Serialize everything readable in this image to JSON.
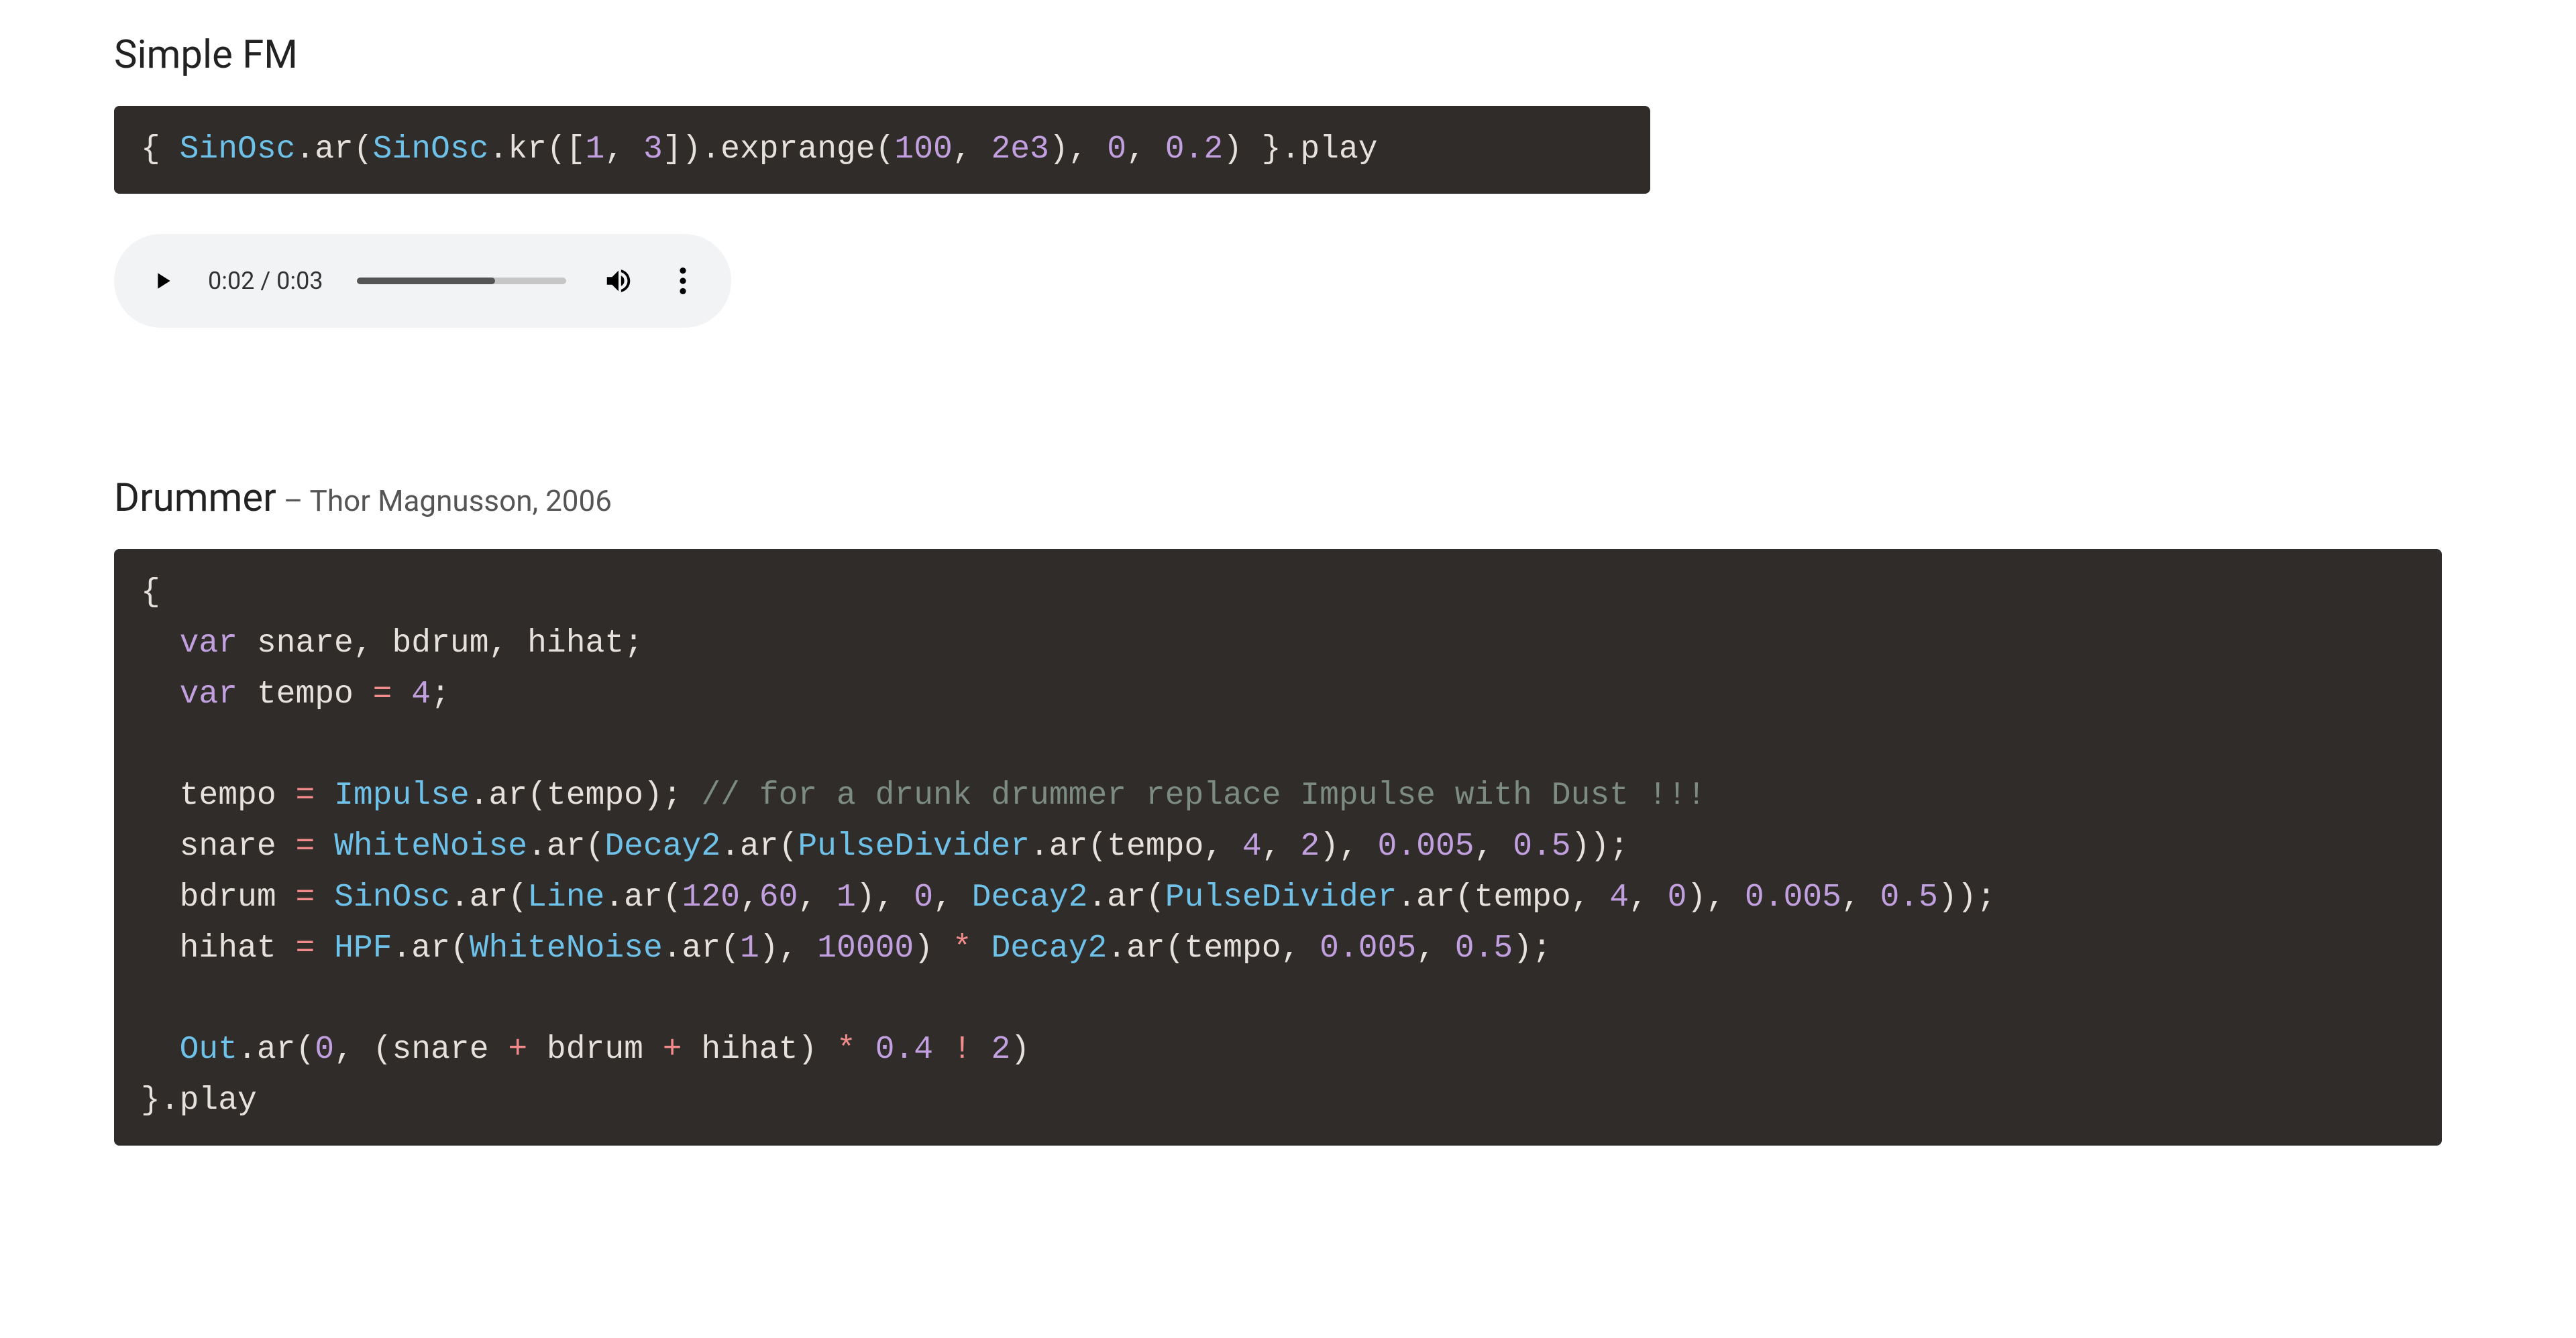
{
  "sections": {
    "fm": {
      "title": "Simple FM",
      "byline": "",
      "code_tokens": [
        {
          "t": "plain",
          "v": "{ "
        },
        {
          "t": "class",
          "v": "SinOsc"
        },
        {
          "t": "plain",
          "v": ".ar("
        },
        {
          "t": "class",
          "v": "SinOsc"
        },
        {
          "t": "plain",
          "v": ".kr(["
        },
        {
          "t": "num",
          "v": "1"
        },
        {
          "t": "plain",
          "v": ", "
        },
        {
          "t": "num",
          "v": "3"
        },
        {
          "t": "plain",
          "v": "]).exprange("
        },
        {
          "t": "num",
          "v": "100"
        },
        {
          "t": "plain",
          "v": ", "
        },
        {
          "t": "num",
          "v": "2e3"
        },
        {
          "t": "plain",
          "v": "), "
        },
        {
          "t": "num",
          "v": "0"
        },
        {
          "t": "plain",
          "v": ", "
        },
        {
          "t": "num",
          "v": "0.2"
        },
        {
          "t": "plain",
          "v": ") }.play"
        }
      ]
    },
    "drummer": {
      "title": "Drummer",
      "byline": " – Thor Magnusson, 2006",
      "code_lines": [
        [
          {
            "t": "plain",
            "v": "{"
          }
        ],
        [
          {
            "t": "plain",
            "v": "  "
          },
          {
            "t": "key",
            "v": "var"
          },
          {
            "t": "plain",
            "v": " snare, bdrum, hihat;"
          }
        ],
        [
          {
            "t": "plain",
            "v": "  "
          },
          {
            "t": "key",
            "v": "var"
          },
          {
            "t": "plain",
            "v": " tempo "
          },
          {
            "t": "op",
            "v": "="
          },
          {
            "t": "plain",
            "v": " "
          },
          {
            "t": "num",
            "v": "4"
          },
          {
            "t": "plain",
            "v": ";"
          }
        ],
        [
          {
            "t": "plain",
            "v": ""
          }
        ],
        [
          {
            "t": "plain",
            "v": "  tempo "
          },
          {
            "t": "op",
            "v": "="
          },
          {
            "t": "plain",
            "v": " "
          },
          {
            "t": "class",
            "v": "Impulse"
          },
          {
            "t": "plain",
            "v": ".ar(tempo); "
          },
          {
            "t": "comment",
            "v": "// for a drunk drummer replace Impulse with Dust !!!"
          }
        ],
        [
          {
            "t": "plain",
            "v": "  snare "
          },
          {
            "t": "op",
            "v": "="
          },
          {
            "t": "plain",
            "v": " "
          },
          {
            "t": "class",
            "v": "WhiteNoise"
          },
          {
            "t": "plain",
            "v": ".ar("
          },
          {
            "t": "class",
            "v": "Decay2"
          },
          {
            "t": "plain",
            "v": ".ar("
          },
          {
            "t": "class",
            "v": "PulseDivider"
          },
          {
            "t": "plain",
            "v": ".ar(tempo, "
          },
          {
            "t": "num",
            "v": "4"
          },
          {
            "t": "plain",
            "v": ", "
          },
          {
            "t": "num",
            "v": "2"
          },
          {
            "t": "plain",
            "v": "), "
          },
          {
            "t": "num",
            "v": "0.005"
          },
          {
            "t": "plain",
            "v": ", "
          },
          {
            "t": "num",
            "v": "0.5"
          },
          {
            "t": "plain",
            "v": "));"
          }
        ],
        [
          {
            "t": "plain",
            "v": "  bdrum "
          },
          {
            "t": "op",
            "v": "="
          },
          {
            "t": "plain",
            "v": " "
          },
          {
            "t": "class",
            "v": "SinOsc"
          },
          {
            "t": "plain",
            "v": ".ar("
          },
          {
            "t": "class",
            "v": "Line"
          },
          {
            "t": "plain",
            "v": ".ar("
          },
          {
            "t": "num",
            "v": "120"
          },
          {
            "t": "plain",
            "v": ","
          },
          {
            "t": "num",
            "v": "60"
          },
          {
            "t": "plain",
            "v": ", "
          },
          {
            "t": "num",
            "v": "1"
          },
          {
            "t": "plain",
            "v": "), "
          },
          {
            "t": "num",
            "v": "0"
          },
          {
            "t": "plain",
            "v": ", "
          },
          {
            "t": "class",
            "v": "Decay2"
          },
          {
            "t": "plain",
            "v": ".ar("
          },
          {
            "t": "class",
            "v": "PulseDivider"
          },
          {
            "t": "plain",
            "v": ".ar(tempo, "
          },
          {
            "t": "num",
            "v": "4"
          },
          {
            "t": "plain",
            "v": ", "
          },
          {
            "t": "num",
            "v": "0"
          },
          {
            "t": "plain",
            "v": "), "
          },
          {
            "t": "num",
            "v": "0.005"
          },
          {
            "t": "plain",
            "v": ", "
          },
          {
            "t": "num",
            "v": "0.5"
          },
          {
            "t": "plain",
            "v": "));"
          }
        ],
        [
          {
            "t": "plain",
            "v": "  hihat "
          },
          {
            "t": "op",
            "v": "="
          },
          {
            "t": "plain",
            "v": " "
          },
          {
            "t": "class",
            "v": "HPF"
          },
          {
            "t": "plain",
            "v": ".ar("
          },
          {
            "t": "class",
            "v": "WhiteNoise"
          },
          {
            "t": "plain",
            "v": ".ar("
          },
          {
            "t": "num",
            "v": "1"
          },
          {
            "t": "plain",
            "v": "), "
          },
          {
            "t": "num",
            "v": "10000"
          },
          {
            "t": "plain",
            "v": ") "
          },
          {
            "t": "op",
            "v": "*"
          },
          {
            "t": "plain",
            "v": " "
          },
          {
            "t": "class",
            "v": "Decay2"
          },
          {
            "t": "plain",
            "v": ".ar(tempo, "
          },
          {
            "t": "num",
            "v": "0.005"
          },
          {
            "t": "plain",
            "v": ", "
          },
          {
            "t": "num",
            "v": "0.5"
          },
          {
            "t": "plain",
            "v": ");"
          }
        ],
        [
          {
            "t": "plain",
            "v": ""
          }
        ],
        [
          {
            "t": "plain",
            "v": "  "
          },
          {
            "t": "class",
            "v": "Out"
          },
          {
            "t": "plain",
            "v": ".ar("
          },
          {
            "t": "num",
            "v": "0"
          },
          {
            "t": "plain",
            "v": ", (snare "
          },
          {
            "t": "op",
            "v": "+"
          },
          {
            "t": "plain",
            "v": " bdrum "
          },
          {
            "t": "op",
            "v": "+"
          },
          {
            "t": "plain",
            "v": " hihat) "
          },
          {
            "t": "op",
            "v": "*"
          },
          {
            "t": "plain",
            "v": " "
          },
          {
            "t": "num",
            "v": "0.4"
          },
          {
            "t": "plain",
            "v": " "
          },
          {
            "t": "op",
            "v": "!"
          },
          {
            "t": "plain",
            "v": " "
          },
          {
            "t": "num",
            "v": "2"
          },
          {
            "t": "plain",
            "v": ")"
          }
        ],
        [
          {
            "t": "plain",
            "v": "}.play"
          }
        ]
      ]
    }
  },
  "audio": {
    "current_time": "0:02",
    "sep": " / ",
    "total_time": "0:03",
    "progress_percent": 66
  }
}
